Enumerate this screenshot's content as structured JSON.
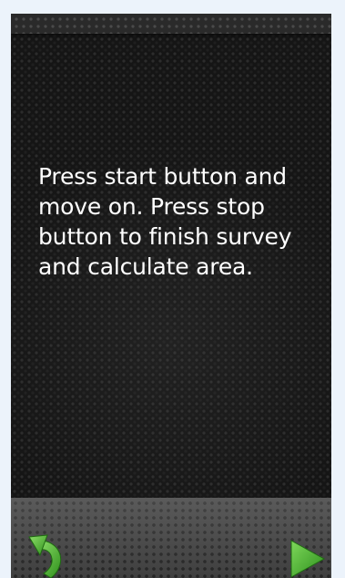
{
  "screen": {
    "instructions": "Press start button and move on. Press stop button to finish survey and calculate area."
  },
  "navigation": {
    "back_icon": "curved-arrow-back-icon",
    "next_icon": "play-arrow-icon",
    "accent_color": "#3fae2a"
  }
}
